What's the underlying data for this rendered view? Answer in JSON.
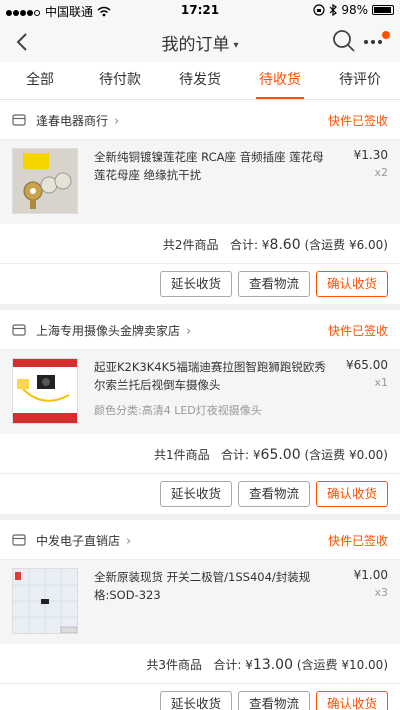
{
  "status_bar": {
    "carrier": "中国联通",
    "time": "17:21",
    "battery": "98%"
  },
  "nav": {
    "title": "我的订单",
    "caret": "▾"
  },
  "tabs": [
    {
      "label": "全部",
      "active": false
    },
    {
      "label": "待付款",
      "active": false
    },
    {
      "label": "待发货",
      "active": false
    },
    {
      "label": "待收货",
      "active": true
    },
    {
      "label": "待评价",
      "active": false
    }
  ],
  "orders": [
    {
      "store": "逢春电器商行",
      "status": "快件已签收",
      "item_title": "全新纯铜镀镍莲花座 RCA座 音频插座 莲花母 莲花母座 绝缘抗干扰",
      "item_sku": "",
      "price": "¥1.30",
      "qty": "x2",
      "summary_count": "共2件商品",
      "summary_total_label": "合计: ¥",
      "summary_total": "8.60",
      "summary_shipping": "(含运费 ¥6.00)"
    },
    {
      "store": "上海专用摄像头金牌卖家店",
      "status": "快件已签收",
      "item_title": "起亚K2K3K4K5福瑞迪赛拉图智跑狮跑锐欧秀尔索兰托后视倒车摄像头",
      "item_sku": "颜色分类:高清4 LED灯夜视摄像头",
      "price": "¥65.00",
      "qty": "x1",
      "summary_count": "共1件商品",
      "summary_total_label": "合计: ¥",
      "summary_total": "65.00",
      "summary_shipping": "(含运费 ¥0.00)"
    },
    {
      "store": "中发电子直销店",
      "status": "快件已签收",
      "item_title": "全新原装现货 开关二极管/1SS404/封装规格:SOD-323",
      "item_sku": "",
      "price": "¥1.00",
      "qty": "x3",
      "summary_count": "共3件商品",
      "summary_total_label": "合计: ¥",
      "summary_total": "13.00",
      "summary_shipping": "(含运费 ¥10.00)"
    }
  ],
  "actions": {
    "extend": "延长收货",
    "logistics": "查看物流",
    "confirm": "确认收货"
  },
  "colors": {
    "accent": "#ff5000"
  }
}
